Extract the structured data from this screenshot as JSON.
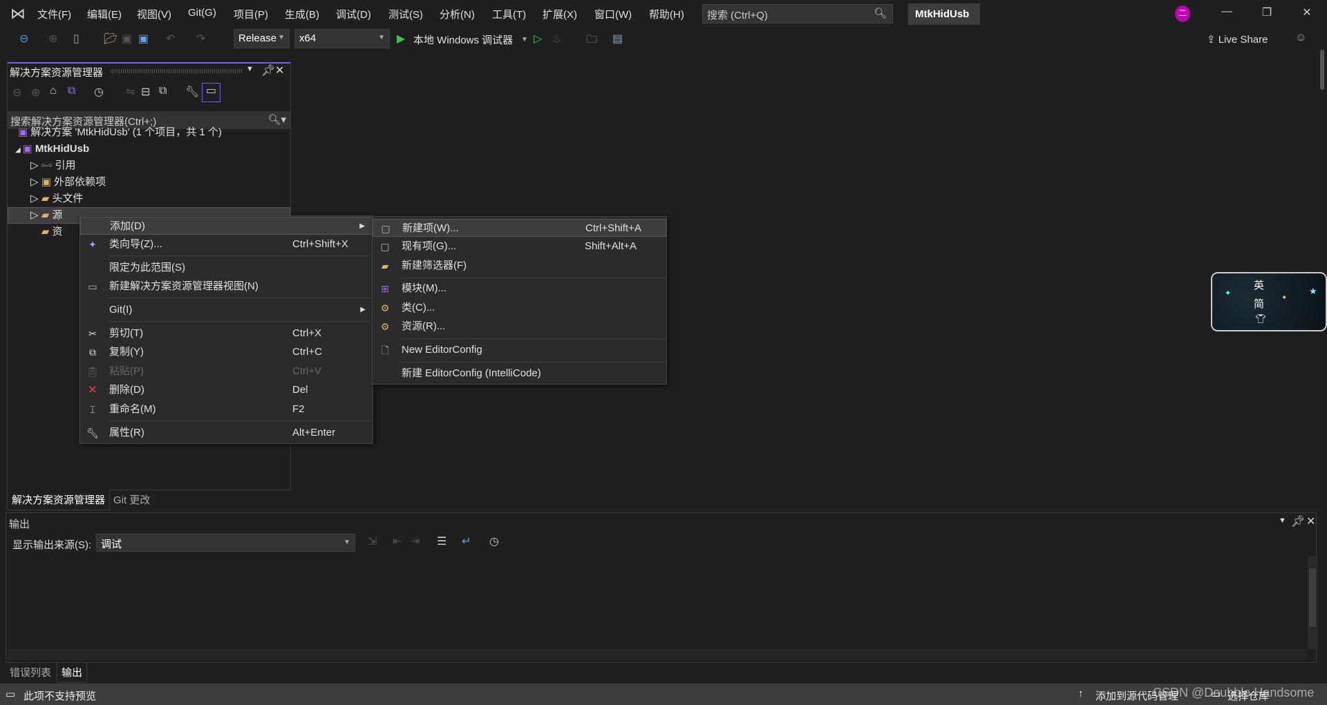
{
  "menubar": {
    "items": [
      "文件(F)",
      "编辑(E)",
      "视图(V)",
      "Git(G)",
      "项目(P)",
      "生成(B)",
      "调试(D)",
      "测试(S)",
      "分析(N)",
      "工具(T)",
      "扩展(X)",
      "窗口(W)",
      "帮助(H)"
    ],
    "search_placeholder": "搜索 (Ctrl+Q)",
    "project_title": "MtkHidUsb",
    "avatar": "二"
  },
  "toolbar": {
    "config": "Release",
    "platform": "x64",
    "debugger": "本地 Windows 调试器",
    "live_share": "Live Share"
  },
  "solution_explorer": {
    "title": "解决方案资源管理器",
    "search_placeholder": "搜索解决方案资源管理器(Ctrl+;)",
    "tree": [
      {
        "label": "解决方案 'MtkHidUsb' (1 个项目，共 1 个)",
        "icon": "solution-icon"
      },
      {
        "label": "MtkHidUsb",
        "icon": "project-icon"
      },
      {
        "label": "引用",
        "icon": "reference-icon"
      },
      {
        "label": "外部依赖项",
        "icon": "external-deps-icon"
      },
      {
        "label": "头文件",
        "icon": "filter-folder-icon"
      },
      {
        "label": "源文件",
        "icon": "filter-folder-icon"
      },
      {
        "label": "资源文件",
        "icon": "filter-folder-icon"
      }
    ],
    "visible_partial": [
      "源",
      "资"
    ],
    "tabs": [
      "解决方案资源管理器",
      "Git 更改"
    ]
  },
  "context_menu": {
    "items": [
      {
        "label": "添加(D)",
        "shortcut": ""
      },
      {
        "label": "类向导(Z)...",
        "shortcut": "Ctrl+Shift+X"
      },
      {
        "label": "限定为此范围(S)",
        "shortcut": ""
      },
      {
        "label": "新建解决方案资源管理器视图(N)",
        "shortcut": ""
      },
      {
        "label": "Git(I)",
        "shortcut": ""
      },
      {
        "label": "剪切(T)",
        "shortcut": "Ctrl+X"
      },
      {
        "label": "复制(Y)",
        "shortcut": "Ctrl+C"
      },
      {
        "label": "粘贴(P)",
        "shortcut": "Ctrl+V"
      },
      {
        "label": "删除(D)",
        "shortcut": "Del"
      },
      {
        "label": "重命名(M)",
        "shortcut": "F2"
      },
      {
        "label": "属性(R)",
        "shortcut": "Alt+Enter"
      }
    ]
  },
  "submenu": {
    "items": [
      {
        "label": "新建项(W)...",
        "shortcut": "Ctrl+Shift+A"
      },
      {
        "label": "现有项(G)...",
        "shortcut": "Shift+Alt+A"
      },
      {
        "label": "新建筛选器(F)",
        "shortcut": ""
      },
      {
        "label": "模块(M)...",
        "shortcut": ""
      },
      {
        "label": "类(C)...",
        "shortcut": ""
      },
      {
        "label": "资源(R)...",
        "shortcut": ""
      },
      {
        "label": "New EditorConfig",
        "shortcut": ""
      },
      {
        "label": "新建 EditorConfig (IntelliCode)",
        "shortcut": ""
      }
    ]
  },
  "output": {
    "title": "输出",
    "source_label": "显示输出来源(S):",
    "source_value": "调试"
  },
  "bottom_tabs": [
    "错误列表",
    "输出"
  ],
  "status": {
    "left": "此项不支持预览",
    "add_source": "添加到源代码管理",
    "select_repo": "选择仓库",
    "watermark": "CSDN @Doubble Handsome"
  },
  "ime": {
    "line1": "英",
    "line2": "简"
  }
}
